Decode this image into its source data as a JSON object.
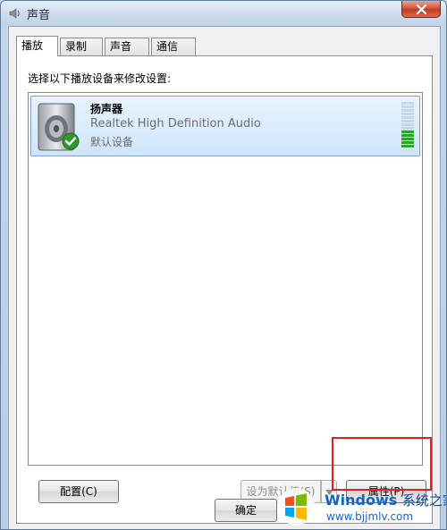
{
  "window": {
    "title": "声音"
  },
  "tabs": [
    {
      "label": "播放",
      "active": true
    },
    {
      "label": "录制",
      "active": false
    },
    {
      "label": "声音",
      "active": false
    },
    {
      "label": "通信",
      "active": false
    }
  ],
  "playback": {
    "instruction": "选择以下播放设备来修改设置:",
    "devices": [
      {
        "name": "扬声器",
        "driver": "Realtek High Definition Audio",
        "status": "默认设备",
        "icon": "speaker-icon",
        "default_badge_icon": "check-icon",
        "level_fraction": 0.4
      }
    ]
  },
  "buttons": {
    "configure": "配置(C)",
    "set_default": "设为默认值(S)",
    "properties": "属性(P)",
    "ok": "确定"
  },
  "watermark": {
    "brand": "Windows",
    "brand_cn": "系统之家",
    "url": "www.bjjmlv.com"
  },
  "colors": {
    "highlight": "#e0201c",
    "selection_border": "#7da2ce",
    "meter_active": "#2aa52a"
  }
}
